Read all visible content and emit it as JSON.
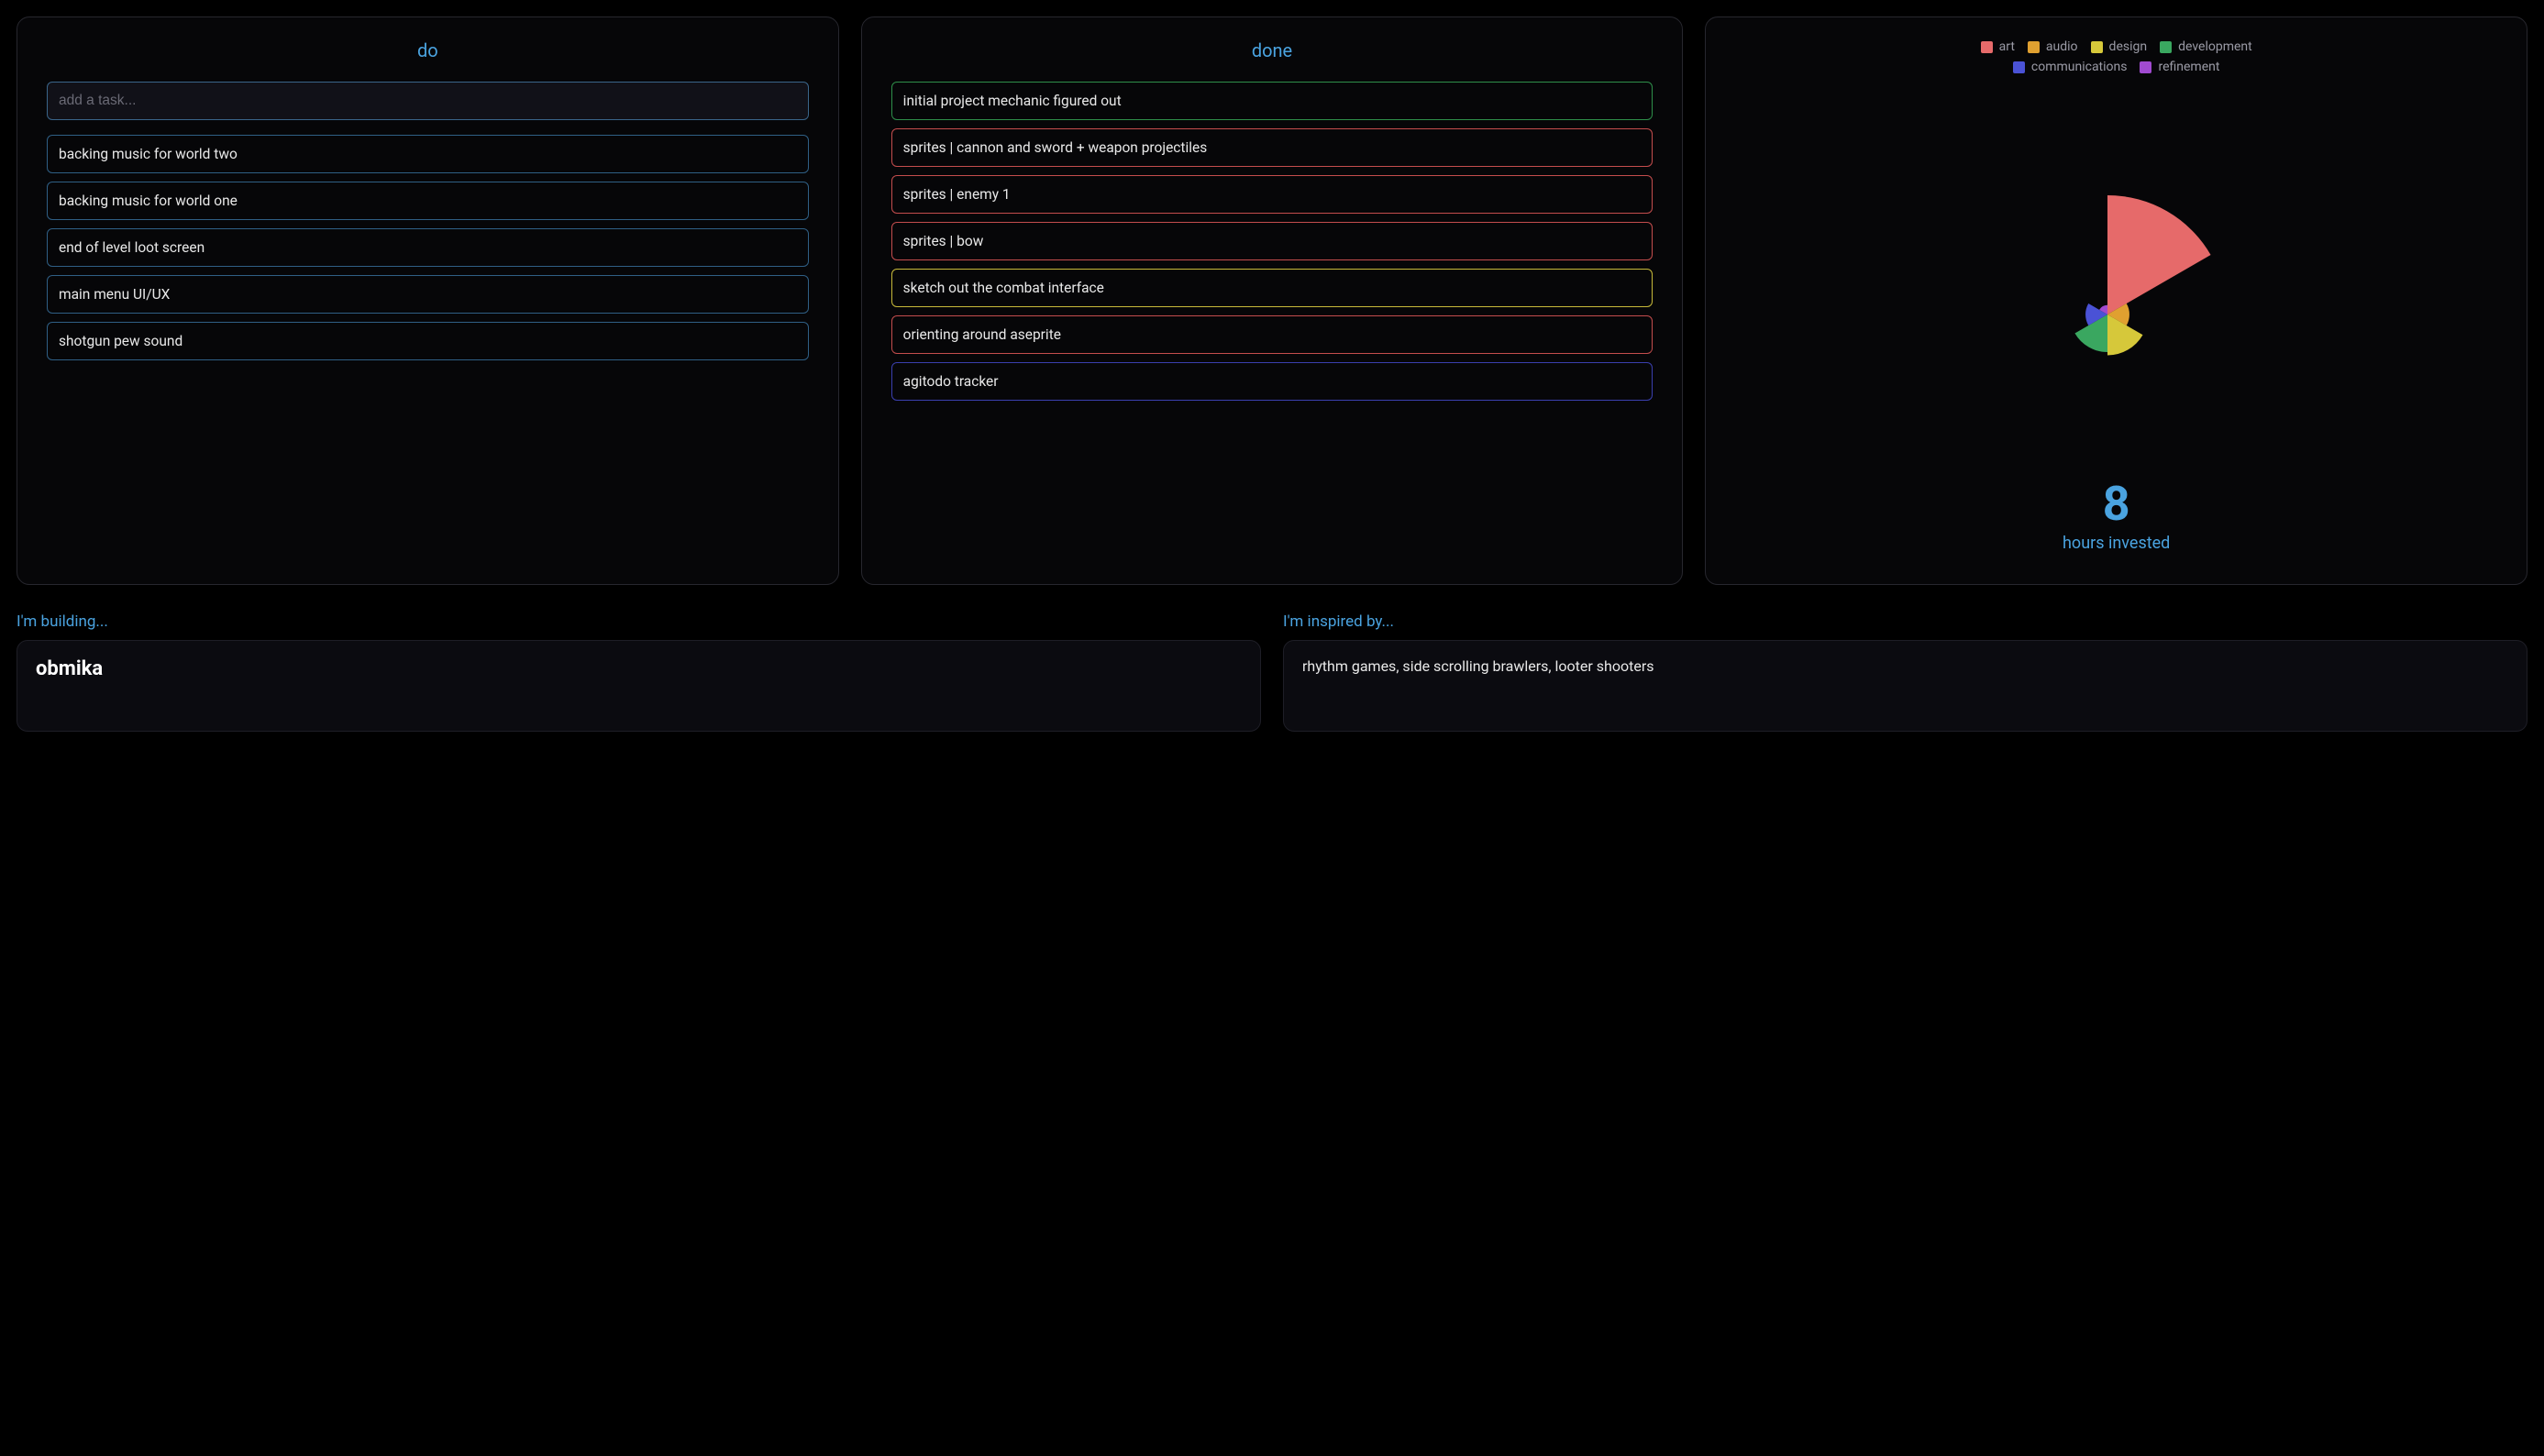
{
  "colors": {
    "art": "#e66a6a",
    "audio": "#e0a030",
    "design": "#d6c83a",
    "development": "#3aa760",
    "communications": "#4a52d6",
    "refinement": "#a04ad0",
    "blue_border": "#2f5f85",
    "green_border": "#2e8f4a",
    "red_border": "#c44d4d",
    "yellow_border": "#c7b93a",
    "purple_border": "#3a3fae"
  },
  "do": {
    "title": "do",
    "input_placeholder": "add a task...",
    "items": [
      {
        "label": "backing music for world two",
        "border": "blue_border"
      },
      {
        "label": "backing music for world one",
        "border": "blue_border"
      },
      {
        "label": "end of level loot screen",
        "border": "blue_border"
      },
      {
        "label": "main menu UI/UX",
        "border": "blue_border"
      },
      {
        "label": "shotgun pew sound",
        "border": "blue_border"
      }
    ]
  },
  "done": {
    "title": "done",
    "items": [
      {
        "label": "initial project mechanic figured out",
        "border": "green_border"
      },
      {
        "label": "sprites | cannon and sword + weapon projectiles",
        "border": "red_border"
      },
      {
        "label": "sprites | enemy 1",
        "border": "red_border"
      },
      {
        "label": "sprites | bow",
        "border": "red_border"
      },
      {
        "label": "sketch out the combat interface",
        "border": "yellow_border"
      },
      {
        "label": "orienting around aseprite",
        "border": "red_border"
      },
      {
        "label": "agitodo tracker",
        "border": "purple_border"
      }
    ]
  },
  "stats": {
    "legend": [
      {
        "label": "art",
        "color": "art"
      },
      {
        "label": "audio",
        "color": "audio"
      },
      {
        "label": "design",
        "color": "design"
      },
      {
        "label": "development",
        "color": "development"
      },
      {
        "label": "communications",
        "color": "communications"
      },
      {
        "label": "refinement",
        "color": "refinement"
      }
    ],
    "hours": "8",
    "hours_label": "hours invested"
  },
  "chart_data": {
    "type": "pie",
    "title": "",
    "series": [
      {
        "name": "art",
        "value": 3.8,
        "color": "#e66a6a"
      },
      {
        "name": "audio",
        "value": 0.7,
        "color": "#e0a030"
      },
      {
        "name": "design",
        "value": 1.3,
        "color": "#d6c83a"
      },
      {
        "name": "development",
        "value": 1.2,
        "color": "#3aa760"
      },
      {
        "name": "communications",
        "value": 0.7,
        "color": "#4a52d6"
      },
      {
        "name": "refinement",
        "value": 0.3,
        "color": "#a04ad0"
      }
    ],
    "note": "polar-area style: slice angle = equal 60deg per category, radius encodes value"
  },
  "building": {
    "label": "I'm building...",
    "text": "obmika"
  },
  "inspired": {
    "label": "I'm inspired by...",
    "text": "rhythm games, side scrolling brawlers, looter shooters"
  }
}
